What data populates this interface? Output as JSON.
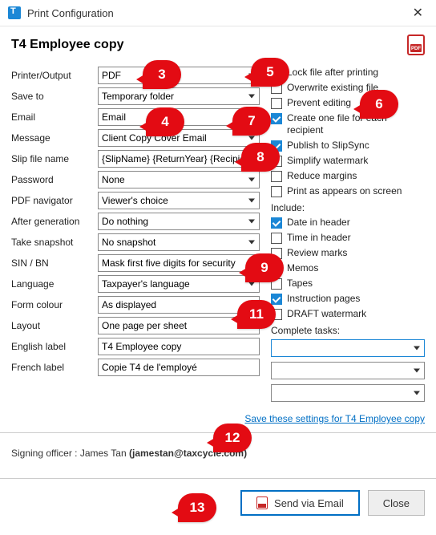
{
  "window": {
    "title": "Print Configuration"
  },
  "header": {
    "title": "T4 Employee copy"
  },
  "fields": {
    "printer_output": {
      "label": "Printer/Output",
      "value": "PDF"
    },
    "save_to": {
      "label": "Save to",
      "value": "Temporary folder"
    },
    "email": {
      "label": "Email",
      "value": "Email"
    },
    "message": {
      "label": "Message",
      "value": "Client Copy Cover Email"
    },
    "slip_file_name": {
      "label": "Slip file name",
      "value": "{SlipName} {ReturnYear} {Recipient"
    },
    "password": {
      "label": "Password",
      "value": "None"
    },
    "pdf_navigator": {
      "label": "PDF navigator",
      "value": "Viewer's choice"
    },
    "after_generation": {
      "label": "After generation",
      "value": "Do nothing"
    },
    "take_snapshot": {
      "label": "Take snapshot",
      "value": "No snapshot"
    },
    "sin_bn": {
      "label": "SIN / BN",
      "value": "Mask first five digits for security"
    },
    "language": {
      "label": "Language",
      "value": "Taxpayer's language"
    },
    "form_colour": {
      "label": "Form colour",
      "value": "As displayed"
    },
    "layout": {
      "label": "Layout",
      "value": "One page per sheet"
    },
    "english_label": {
      "label": "English label",
      "value": "T4 Employee copy"
    },
    "french_label": {
      "label": "French label",
      "value": "Copie T4 de l'employé"
    }
  },
  "options": {
    "lock_file": {
      "label": "Lock file after printing",
      "checked": false
    },
    "overwrite": {
      "label": "Overwrite existing file",
      "checked": false
    },
    "prevent_editing": {
      "label": "Prevent editing",
      "checked": false
    },
    "one_per_recipient": {
      "label": "Create one file for each recipient",
      "checked": true
    },
    "publish_slipsync": {
      "label": "Publish to SlipSync",
      "checked": true
    },
    "simplify_watermark": {
      "label": "Simplify watermark",
      "checked": false
    },
    "reduce_margins": {
      "label": "Reduce margins",
      "checked": false
    },
    "print_as_screen": {
      "label": "Print as appears on screen",
      "checked": false
    }
  },
  "include": {
    "title": "Include:",
    "date_header": {
      "label": "Date in header",
      "checked": true
    },
    "time_header": {
      "label": "Time in header",
      "checked": false
    },
    "review_marks": {
      "label": "Review marks",
      "checked": false
    },
    "memos": {
      "label": "Memos",
      "checked": false
    },
    "tapes": {
      "label": "Tapes",
      "checked": false
    },
    "instruction_pages": {
      "label": "Instruction pages",
      "checked": true
    },
    "draft_watermark": {
      "label": "DRAFT watermark",
      "checked": false
    }
  },
  "complete_tasks": {
    "title": "Complete tasks:"
  },
  "save_link": "Save these settings for T4 Employee copy",
  "signing": {
    "prefix": "Signing officer :  ",
    "name": "James Tan ",
    "email": "(jamestan@taxcycle.com)"
  },
  "buttons": {
    "send": "Send via Email",
    "close": "Close"
  },
  "callouts": {
    "c3": "3",
    "c4": "4",
    "c5": "5",
    "c6": "6",
    "c7": "7",
    "c8": "8",
    "c9": "9",
    "c11": "11",
    "c12": "12",
    "c13": "13"
  }
}
